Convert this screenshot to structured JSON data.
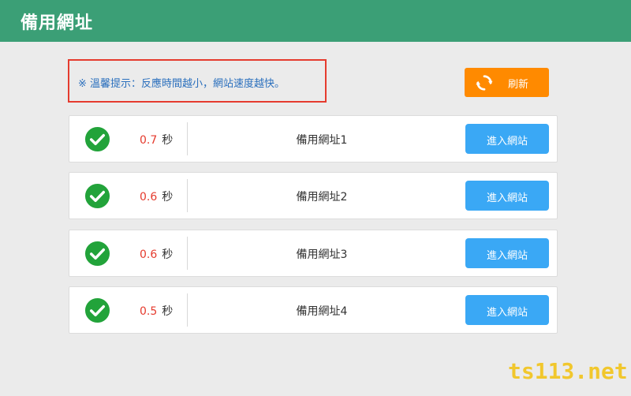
{
  "header": {
    "title": "備用網址"
  },
  "tip": {
    "text": "※ 溫馨提示：反應時間越小，網站速度越快。"
  },
  "refresh": {
    "label": "刷新",
    "icon": "refresh-icon",
    "color": "#ff8a00"
  },
  "sites": [
    {
      "latency": "0.7",
      "unit": "秒",
      "name": "備用網址1",
      "button": "進入網站",
      "status_icon": "check-circle-icon"
    },
    {
      "latency": "0.6",
      "unit": "秒",
      "name": "備用網址2",
      "button": "進入網站",
      "status_icon": "check-circle-icon"
    },
    {
      "latency": "0.6",
      "unit": "秒",
      "name": "備用網址3",
      "button": "進入網站",
      "status_icon": "check-circle-icon"
    },
    {
      "latency": "0.5",
      "unit": "秒",
      "name": "備用網址4",
      "button": "進入網站",
      "status_icon": "check-circle-icon"
    }
  ],
  "watermark": {
    "text": "ts113.net"
  },
  "colors": {
    "header": "#3b9f76",
    "tip_text": "#2a6fbd",
    "tip_border": "#e53b2e",
    "latency": "#e53b2e",
    "enter_button": "#3aa8f5",
    "status_ok": "#22a33a",
    "watermark": "#f2c51d"
  }
}
